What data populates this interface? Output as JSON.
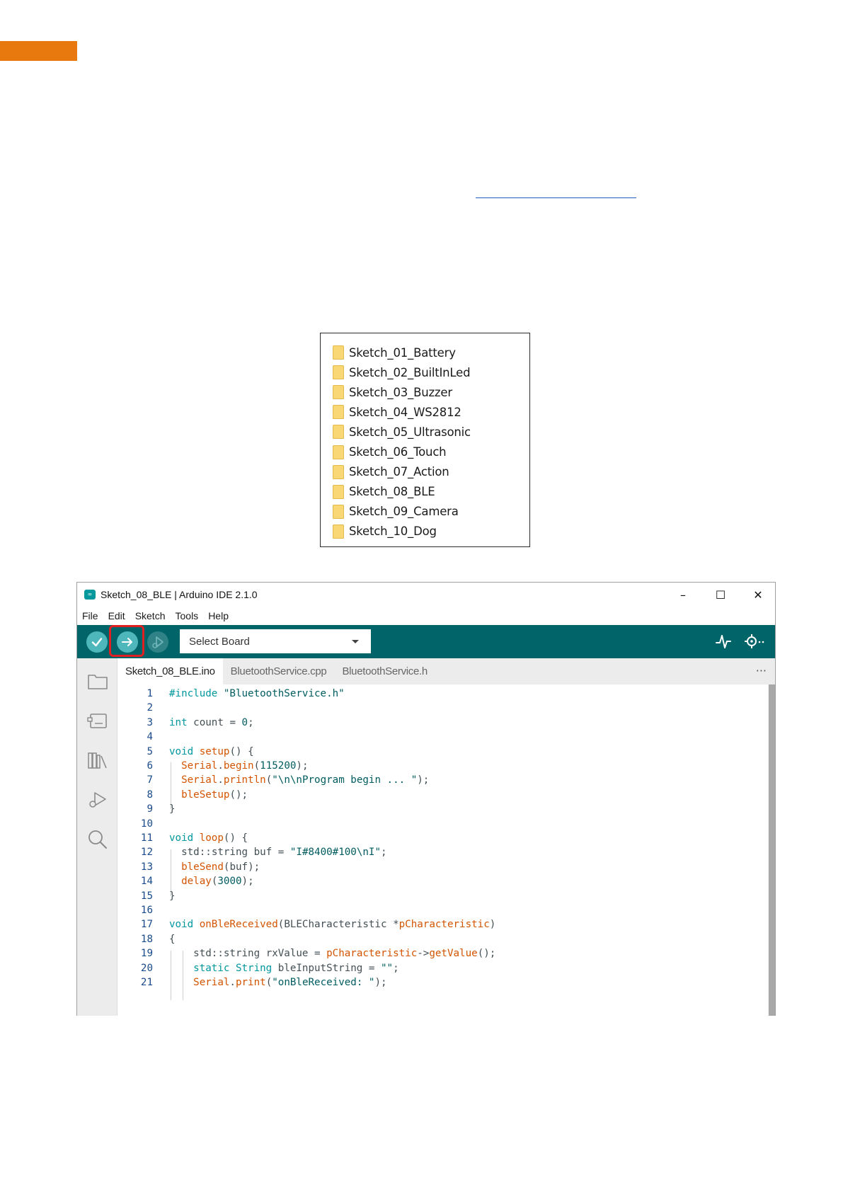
{
  "folders": [
    "Sketch_01_Battery",
    "Sketch_02_BuiltInLed",
    "Sketch_03_Buzzer",
    "Sketch_04_WS2812",
    "Sketch_05_Ultrasonic",
    "Sketch_06_Touch",
    "Sketch_07_Action",
    "Sketch_08_BLE",
    "Sketch_09_Camera",
    "Sketch_10_Dog"
  ],
  "ide": {
    "title": "Sketch_08_BLE | Arduino IDE 2.1.0",
    "window_controls": {
      "minimize": "–",
      "maximize": "☐",
      "close": "✕"
    },
    "menu": [
      "File",
      "Edit",
      "Sketch",
      "Tools",
      "Help"
    ],
    "board_select": "Select Board",
    "tabs": [
      "Sketch_08_BLE.ino",
      "BluetoothService.cpp",
      "BluetoothService.h"
    ],
    "active_tab": 0,
    "more": "···",
    "colors": {
      "toolbar": "#006468",
      "button": "#4db7bb",
      "highlight": "#e02020",
      "accent": "#e8790f"
    },
    "sidebar_icons": [
      "folder-icon",
      "board-manager-icon",
      "library-icon",
      "debug-icon",
      "search-icon"
    ],
    "code": [
      "#include \"BluetoothService.h\"",
      "",
      "int count = 0;",
      "",
      "void setup() {",
      "  Serial.begin(115200);",
      "  Serial.println(\"\\n\\nProgram begin ... \");",
      "  bleSetup();",
      "}",
      "",
      "void loop() {",
      "  std::string buf = \"I#8400#100\\nI\";",
      "  bleSend(buf);",
      "  delay(3000);",
      "}",
      "",
      "void onBleReceived(BLECharacteristic *pCharacteristic)",
      "{",
      "    std::string rxValue = pCharacteristic->getValue();",
      "    static String bleInputString = \"\";",
      "    Serial.print(\"onBleReceived: \");"
    ]
  }
}
